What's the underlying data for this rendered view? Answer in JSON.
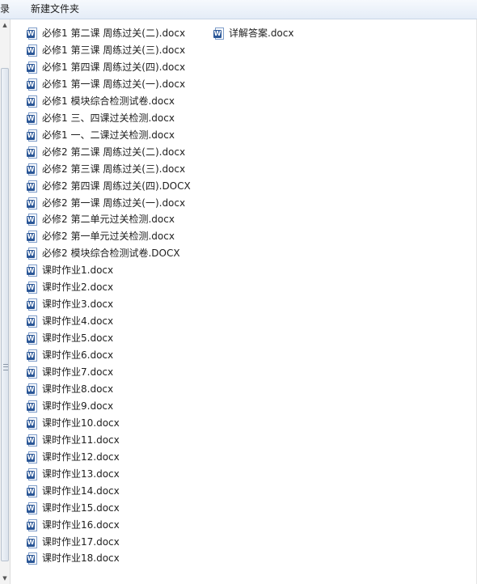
{
  "toolbar": {
    "partial_label": "录",
    "new_folder_label": "新建文件夹"
  },
  "icons": {
    "file": "word-document-icon",
    "badge_letter": "W"
  },
  "files": [
    "必修1  第二课   周练过关(二).docx",
    "必修1  第三课   周练过关(三).docx",
    "必修1  第四课   周练过关(四).docx",
    "必修1  第一课   周练过关(一).docx",
    "必修1   模块综合检测试卷.docx",
    "必修1   三、四课过关检测.docx",
    "必修1   一、二课过关检测.docx",
    "必修2  第二课   周练过关(二).docx",
    "必修2  第三课   周练过关(三).docx",
    "必修2  第四课   周练过关(四).DOCX",
    "必修2  第一课   周练过关(一).docx",
    "必修2   第二单元过关检测.docx",
    "必修2   第一单元过关检测.docx",
    "必修2   模块综合检测试卷.DOCX",
    "课时作业1.docx",
    "课时作业2.docx",
    "课时作业3.docx",
    "课时作业4.docx",
    "课时作业5.docx",
    "课时作业6.docx",
    "课时作业7.docx",
    "课时作业8.docx",
    "课时作业9.docx",
    "课时作业10.docx",
    "课时作业11.docx",
    "课时作业12.docx",
    "课时作业13.docx",
    "课时作业14.docx",
    "课时作业15.docx",
    "课时作业16.docx",
    "课时作业17.docx",
    "课时作业18.docx"
  ],
  "side_files": [
    "详解答案.docx"
  ]
}
